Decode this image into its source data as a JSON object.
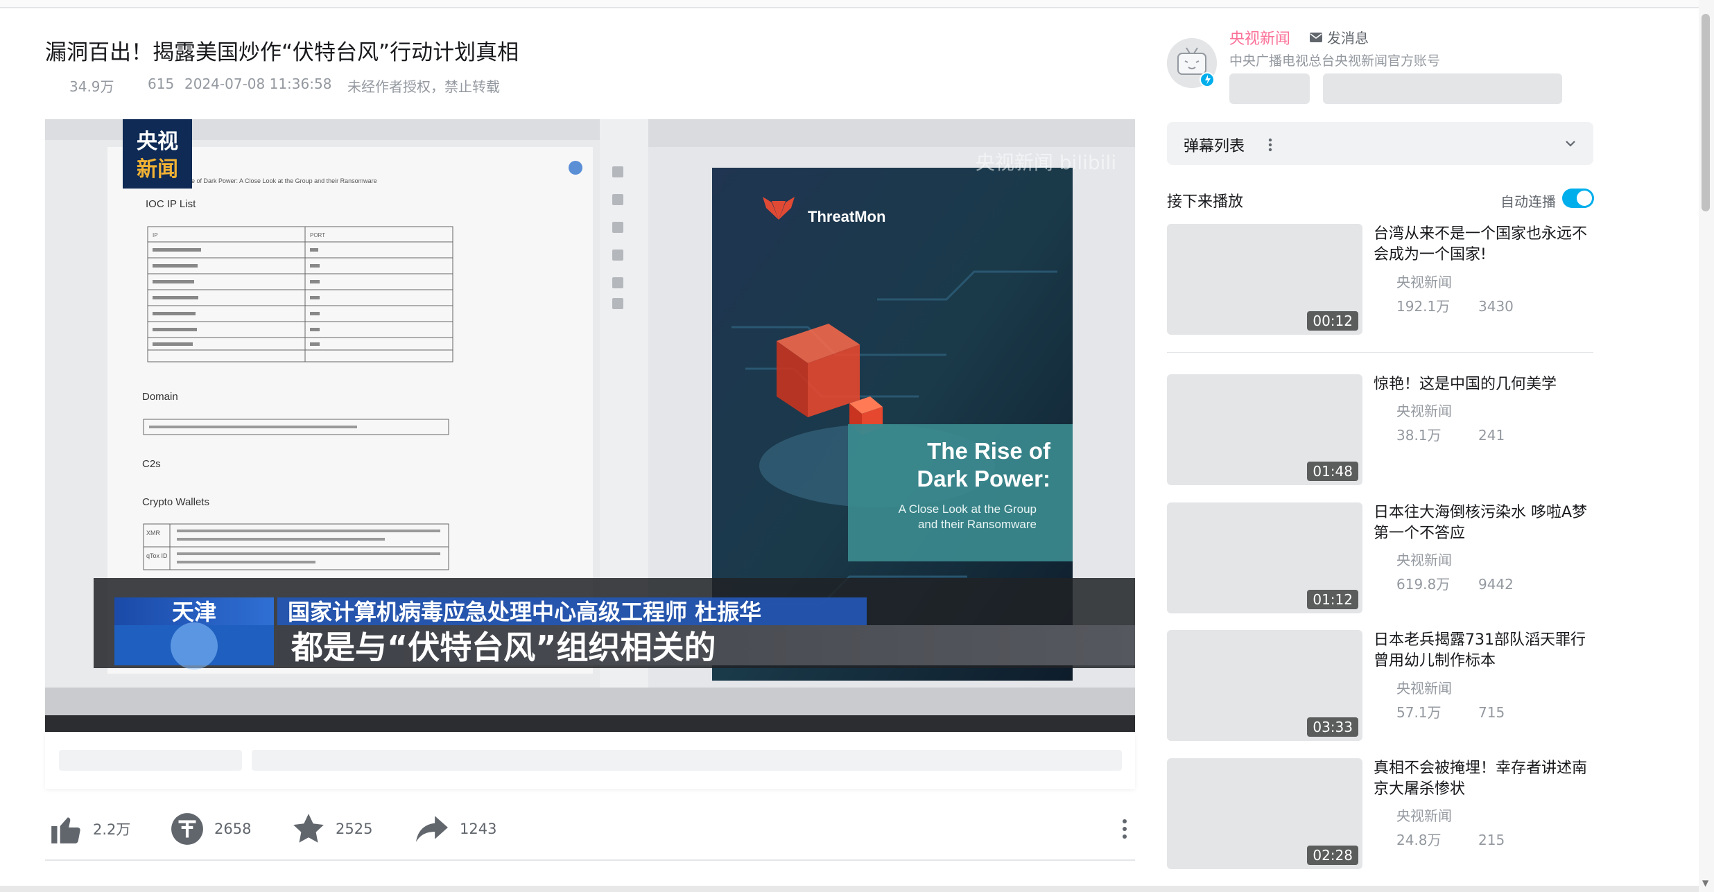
{
  "video": {
    "title": "漏洞百出！揭露美国炒作“伏特台风”行动计划真相",
    "views": "34.9万",
    "danmaku": "615",
    "date": "2024-07-08 11:36:58",
    "notice": "未经作者授权，禁止转载"
  },
  "player": {
    "logo_line1": "央视",
    "logo_line2": "新闻",
    "watermark": "央视新闻 bilibili",
    "doc_subtitle": "The Rise of Dark Power: A Close Look at the Group and their Ransomware",
    "doc_heading_ioc": "IOC IP List",
    "doc_ip_header": "IP",
    "doc_port_header": "PORT",
    "doc_domain": "Domain",
    "doc_c2s": "C2s",
    "doc_wallets": "Crypto Wallets",
    "doc_xmr": "XMR",
    "doc_qtox": "qTox ID",
    "cover_brand": "ThreatMon",
    "cover_title1": "The Rise of",
    "cover_title2": "Dark Power:",
    "cover_sub1": "A Close Look at the Group",
    "cover_sub2": "and their Ransomware",
    "caption_location": "天津",
    "caption_speaker": "国家计算机病毒应急处理中心高级工程师 杜振华",
    "caption_text": "都是与“伏特台风”组织相关的"
  },
  "actions": {
    "like": "2.2万",
    "coin": "2658",
    "favorite": "2525",
    "share": "1243"
  },
  "channel": {
    "name": "央视新闻",
    "message_label": "发消息",
    "description": "中央广播电视总台央视新闻官方账号"
  },
  "danmaku_panel": {
    "label": "弹幕列表"
  },
  "next_up": {
    "label": "接下来播放",
    "autoplay_label": "自动连播",
    "autoplay_on": true
  },
  "recommendations": [
    {
      "title": "台湾从来不是一个国家也永远不会成为一个国家!",
      "owner": "央视新闻",
      "views": "192.1万",
      "danmaku": "3430",
      "duration": "00:12"
    },
    {
      "title": "惊艳！这是中国的几何美学",
      "owner": "央视新闻",
      "views": "38.1万",
      "danmaku": "241",
      "duration": "01:48"
    },
    {
      "title": "日本往大海倒核污染水 哆啦A梦第一个不答应",
      "owner": "央视新闻",
      "views": "619.8万",
      "danmaku": "9442",
      "duration": "01:12"
    },
    {
      "title": "日本老兵揭露731部队滔天罪行 曾用幼儿制作标本",
      "owner": "央视新闻",
      "views": "57.1万",
      "danmaku": "715",
      "duration": "03:33"
    },
    {
      "title": "真相不会被掩埋！幸存者讲述南京大屠杀惨状",
      "owner": "央视新闻",
      "views": "24.8万",
      "danmaku": "215",
      "duration": "02:28"
    }
  ],
  "colors": {
    "accent_pink": "#fb7299",
    "accent_blue": "#00aeec",
    "text_gray": "#9499a0"
  }
}
